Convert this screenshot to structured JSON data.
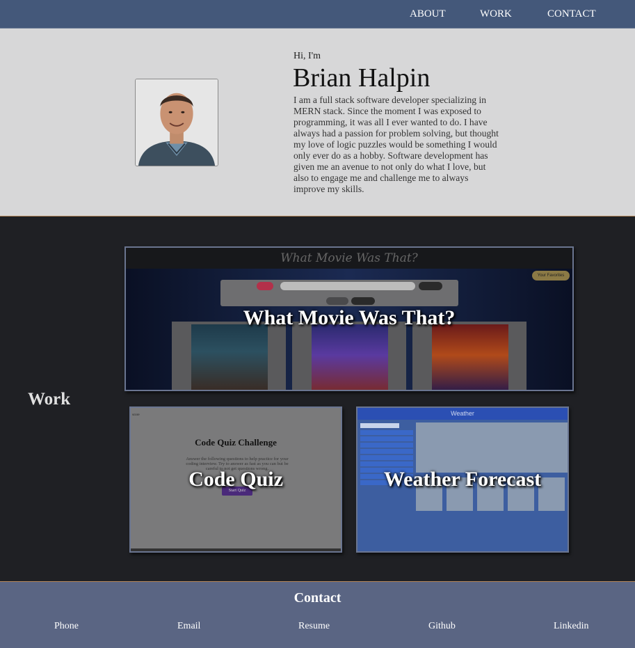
{
  "nav": {
    "about_label": "ABOUT",
    "work_label": "WORK",
    "contact_label": "CONTACT"
  },
  "about": {
    "greeting": "Hi, I'm",
    "name": "Brian Halpin",
    "bio": "I am a full stack software developer specializing in MERN stack. Since the moment I was exposed to programming, it was all I ever wanted to do. I have always had a passion for problem solving, but thought my love of logic puzzles would be something I would only ever do as a hobby. Software development has given me an avenue to not only do what I love, but also to engage me and challenge me to always improve my skills."
  },
  "work": {
    "heading": "Work",
    "projects": [
      {
        "title": "What Movie Was That?",
        "screenshot_header": "What Movie Was That?",
        "screenshot_favorites": "Your Favorites"
      },
      {
        "title": "Code Quiz",
        "screenshot_title": "Code Quiz Challenge",
        "screenshot_text": "Answer the following questions to help practice for your coding interview. Try to answer as fast as you can but be careful to not get questions wrong.",
        "screenshot_button": "Start Quiz",
        "screenshot_corner": "score"
      },
      {
        "title": "Weather Forecast",
        "screenshot_header": "Weather"
      }
    ]
  },
  "footer": {
    "heading": "Contact",
    "links": {
      "phone": "Phone",
      "email": "Email",
      "resume": "Resume",
      "github": "Github",
      "linkedin": "Linkedin"
    }
  },
  "colors": {
    "nav_bg": "#44587a",
    "about_bg": "#d7d7d8",
    "work_bg": "#1f2024",
    "footer_bg": "#5a6583",
    "section_divider": "#b4875a"
  }
}
